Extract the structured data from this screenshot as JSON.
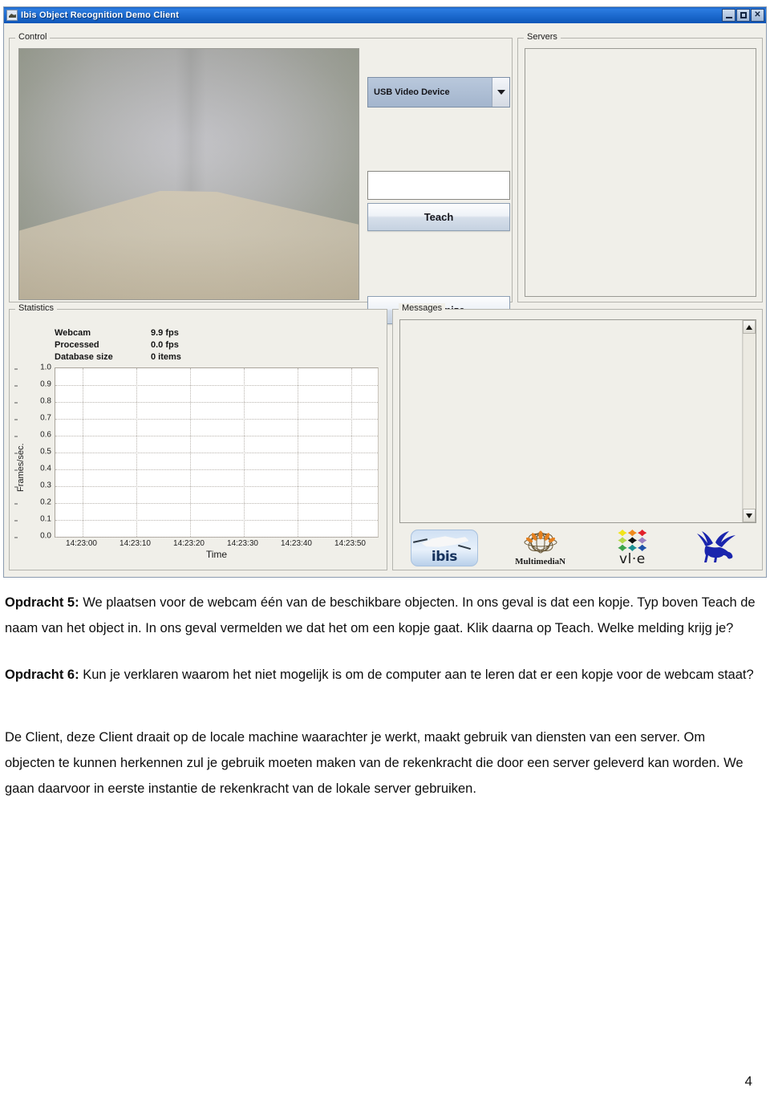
{
  "window": {
    "title": "Ibis Object Recognition Demo Client",
    "icon": "app-bird-icon",
    "minimize_label": "_",
    "maximize_label": "□",
    "close_label": "✕"
  },
  "control": {
    "title": "Control",
    "webcam_preview_alt": "webcam-live-preview",
    "device_select": {
      "value": "USB Video Device",
      "options": [
        "USB Video Device"
      ]
    },
    "object_name_input": {
      "value": "",
      "placeholder": ""
    },
    "teach_label": "Teach",
    "recognize_label": "Recognize"
  },
  "servers": {
    "title": "Servers",
    "items": []
  },
  "statistics": {
    "title": "Statistics",
    "rows": [
      {
        "label": "Webcam",
        "value": "9.9 fps"
      },
      {
        "label": "Processed",
        "value": "0.0 fps"
      },
      {
        "label": "Database size",
        "value": "0 items"
      }
    ]
  },
  "chart_data": {
    "type": "line",
    "title": "",
    "xlabel": "Time",
    "ylabel": "Frames/sec.",
    "ylim": [
      0.0,
      1.0
    ],
    "yticks": [
      "1.0",
      "0.9",
      "0.8",
      "0.7",
      "0.6",
      "0.5",
      "0.4",
      "0.3",
      "0.2",
      "0.1",
      "0.0"
    ],
    "xticks": [
      "14:23:00",
      "14:23:10",
      "14:23:20",
      "14:23:30",
      "14:23:40",
      "14:23:50"
    ],
    "grid": true,
    "legend": "none",
    "series": [
      {
        "name": "Frames/sec.",
        "x": [],
        "values": []
      }
    ]
  },
  "messages": {
    "title": "Messages",
    "items": [],
    "scroll_up_icon": "scroll-up-arrow-icon",
    "scroll_down_icon": "scroll-down-arrow-icon"
  },
  "logos": [
    {
      "name": "ibis-logo",
      "text": "ibis"
    },
    {
      "name": "multimedian-logo",
      "text": "MultimediaN"
    },
    {
      "name": "vle-logo",
      "text": "vl·e"
    },
    {
      "name": "vu-lion-logo",
      "text": ""
    }
  ],
  "vle_colors": [
    "#f2e41a",
    "#f08a1c",
    "#e2202a",
    "#b7d84a",
    "#111111",
    "#9a7fc0",
    "#3aa34a",
    "#1b8f92",
    "#1f52a8"
  ],
  "document": {
    "paragraphs": [
      {
        "lead": "Opdracht 5:",
        "text": " We plaatsen voor de webcam één van de beschikbare objecten. In ons geval is dat een kopje. Typ boven Teach de naam van het object in. In ons geval vermelden we dat het om een kopje gaat. Klik daarna op Teach. Welke melding krijg je?"
      },
      {
        "lead": "Opdracht 6:",
        "text": " Kun je verklaren waarom het niet mogelijk is om de computer aan te leren dat er een kopje voor de webcam staat?"
      },
      {
        "lead": "",
        "text": "De Client, deze Client draait op de locale machine waarachter je werkt,  maakt gebruik van diensten van een server. Om objecten te kunnen herkennen zul je gebruik moeten maken van de rekenkracht die door een server geleverd kan worden. We gaan daarvoor in eerste instantie de rekenkracht van de lokale server gebruiken."
      }
    ],
    "page_number": "4"
  }
}
